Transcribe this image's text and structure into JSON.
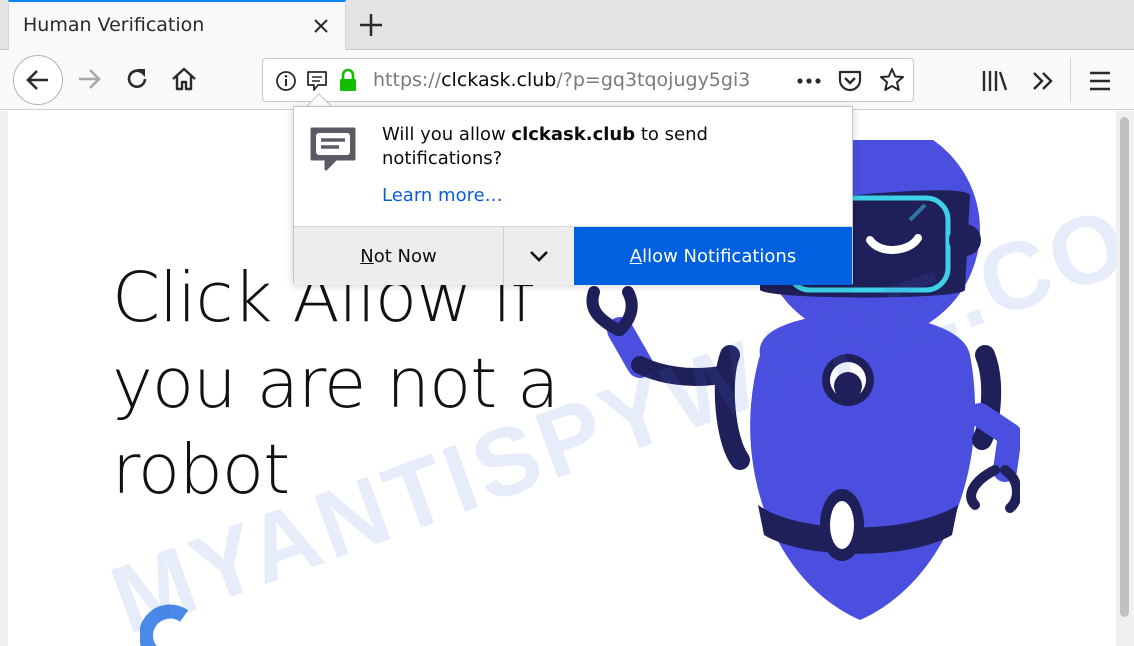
{
  "tab": {
    "title": "Human Verification"
  },
  "url": {
    "prefix": "https://",
    "host": "clckask.club",
    "path": "/?p=gq3tqojugy5gi3"
  },
  "page": {
    "headline_lines": [
      "Click Allow if",
      "you are not a",
      "robot"
    ]
  },
  "popup": {
    "msg_pre": "Will you allow ",
    "msg_site": "clckask.club",
    "msg_post": " to send notifications?",
    "learn_more": "Learn more…",
    "not_now_key": "N",
    "not_now_rest": "ot Now",
    "allow_key": "A",
    "allow_rest": "llow Notifications"
  },
  "watermark": "MYANTISPYWARE.COM",
  "colors": {
    "accent": "#0060df",
    "robot": "#4a4fe0",
    "robot_dark": "#1f1f5a",
    "visor": "#3dd0e8"
  },
  "icons": [
    "close-icon",
    "plus-icon",
    "back-icon",
    "forward-icon",
    "reload-icon",
    "home-icon",
    "info-icon",
    "notification-icon",
    "lock-icon",
    "more-icon",
    "pocket-icon",
    "star-icon",
    "library-icon",
    "overflow-icon",
    "menu-icon",
    "chevron-down-icon",
    "chat-icon"
  ]
}
